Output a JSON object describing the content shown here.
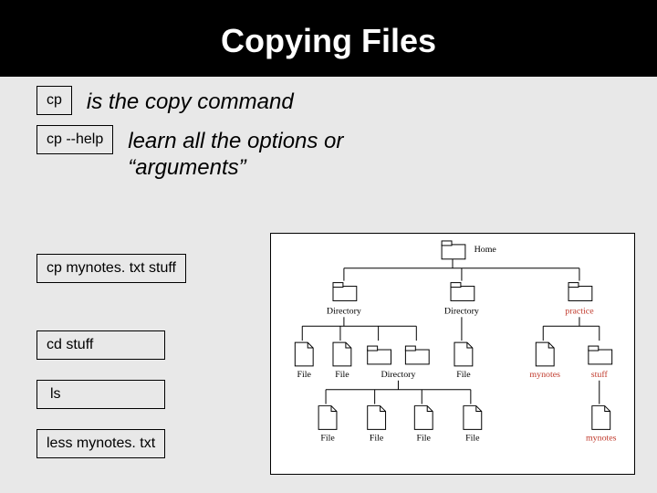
{
  "header": {
    "title": "Copying Files"
  },
  "rows": {
    "cp_label": "cp",
    "cp_desc": "is the copy command",
    "cphelp_label": "cp   --help",
    "cphelp_desc": "learn all the options or “arguments”"
  },
  "commands": {
    "cp_example": "cp   mynotes. txt   stuff",
    "cd": "cd  stuff",
    "ls": "ls",
    "less": "less   mynotes. txt"
  },
  "tree": {
    "home": "Home",
    "dir": "Directory",
    "file": "File",
    "practice": "practice",
    "stuff": "stuff",
    "mynotes": "mynotes"
  }
}
